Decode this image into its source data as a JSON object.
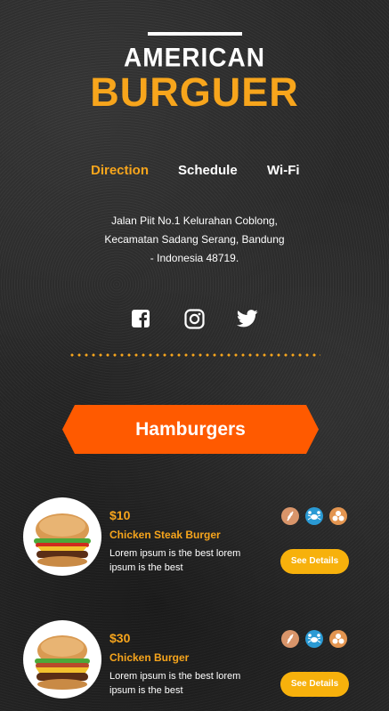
{
  "brand": {
    "line1": "AMERICAN",
    "line2": "BURGUER",
    "accent": "#f7a51c"
  },
  "tabs": [
    {
      "label": "Direction",
      "active": true
    },
    {
      "label": "Schedule",
      "active": false
    },
    {
      "label": "Wi-Fi",
      "active": false
    }
  ],
  "address": {
    "line1": "Jalan Piit No.1 Kelurahan Coblong,",
    "line2": "Kecamatan Sadang Serang, Bandung",
    "line3": "- Indonesia 48719."
  },
  "social": [
    "facebook-icon",
    "instagram-icon",
    "twitter-icon"
  ],
  "section": {
    "title": "Hamburgers",
    "color": "#ff5a00"
  },
  "menu": [
    {
      "price": "$10",
      "name": "Chicken Steak Burger",
      "description": "Lorem ipsum is the best lorem ipsum is the best",
      "button": "See Details",
      "badges": [
        "wheat-icon",
        "crab-icon",
        "egg-icon"
      ]
    },
    {
      "price": "$30",
      "name": "Chicken Burger",
      "description": "Lorem ipsum is the best lorem ipsum is the best",
      "button": "See Details",
      "badges": [
        "wheat-icon",
        "crab-icon",
        "egg-icon"
      ]
    }
  ]
}
